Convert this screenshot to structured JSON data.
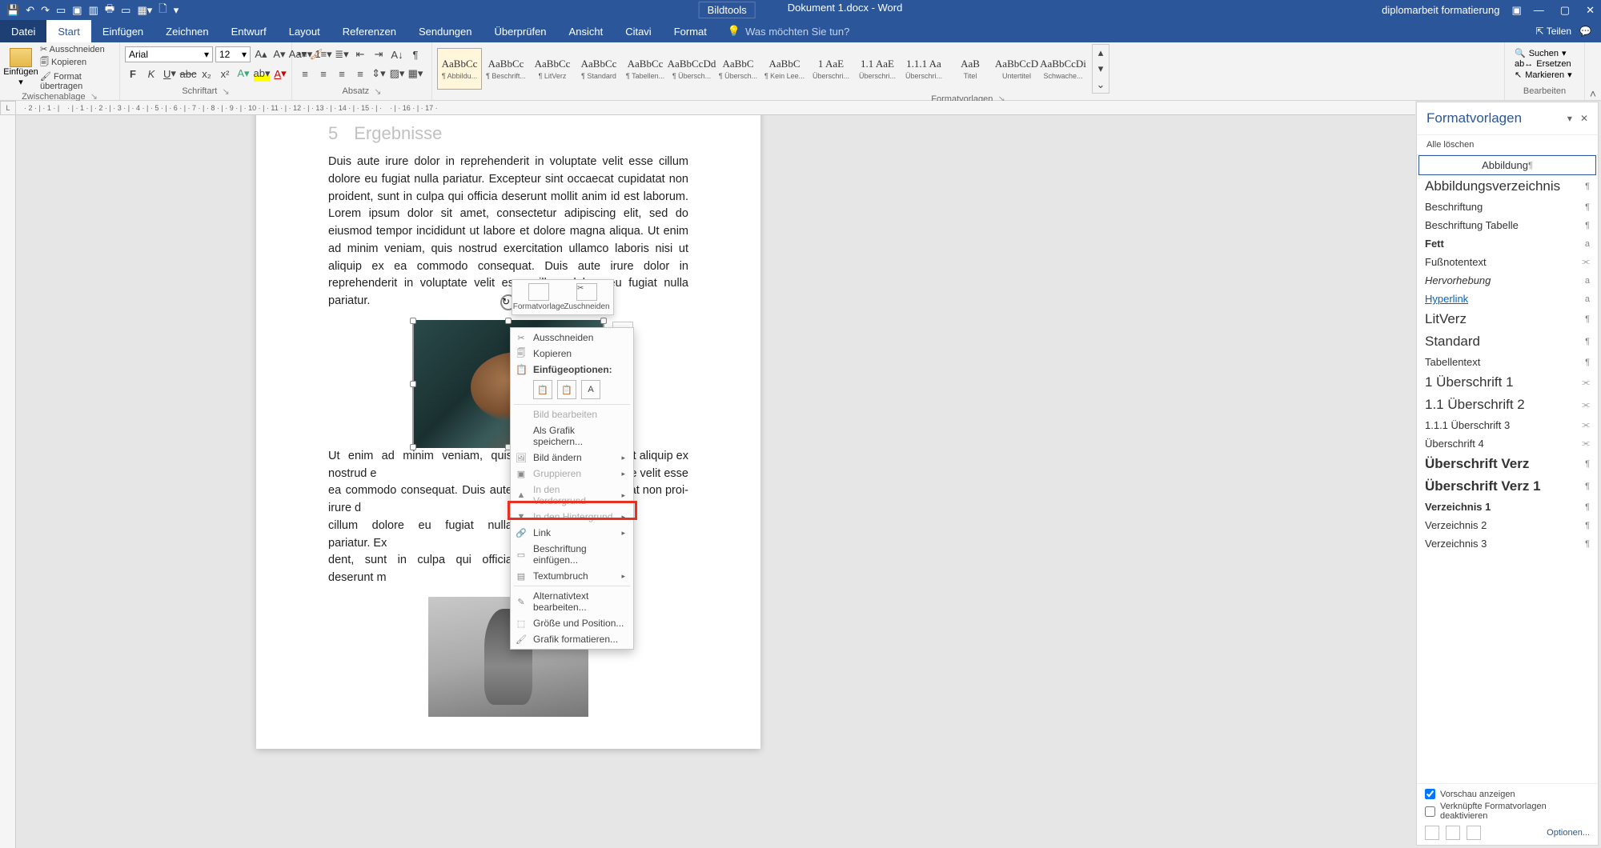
{
  "titlebar": {
    "tools": "Bildtools",
    "docname": "Dokument 1.docx - Word",
    "account": "diplomarbeit formatierung"
  },
  "tabs": {
    "file": "Datei",
    "start": "Start",
    "insert": "Einfügen",
    "draw": "Zeichnen",
    "design": "Entwurf",
    "layout": "Layout",
    "references": "Referenzen",
    "mailings": "Sendungen",
    "review": "Überprüfen",
    "view": "Ansicht",
    "citavi": "Citavi",
    "format": "Format",
    "tellme": "Was möchten Sie tun?",
    "share": "Teilen"
  },
  "ribbon": {
    "clipboard": {
      "label": "Zwischenablage",
      "paste": "Einfügen",
      "cut": "Ausschneiden",
      "copy": "Kopieren",
      "formatpainter": "Format übertragen"
    },
    "font": {
      "label": "Schriftart",
      "name": "Arial",
      "size": "12"
    },
    "paragraph": {
      "label": "Absatz"
    },
    "styles": {
      "label": "Formatvorlagen",
      "items": [
        {
          "sample": "AaBbCc",
          "name": "¶ Abbildu..."
        },
        {
          "sample": "AaBbCc",
          "name": "¶ Beschrift..."
        },
        {
          "sample": "AaBbCc",
          "name": "¶ LitVerz"
        },
        {
          "sample": "AaBbCc",
          "name": "¶ Standard"
        },
        {
          "sample": "AaBbCc",
          "name": "¶ Tabellen..."
        },
        {
          "sample": "AaBbCcDd",
          "name": "¶ Übersch..."
        },
        {
          "sample": "AaBbC",
          "name": "¶ Übersch..."
        },
        {
          "sample": "AaBbC",
          "name": "¶ Kein Lee..."
        },
        {
          "sample": "1 AaE",
          "name": "Überschri..."
        },
        {
          "sample": "1.1 AaE",
          "name": "Überschri..."
        },
        {
          "sample": "1.1.1 Aa",
          "name": "Überschri..."
        },
        {
          "sample": "AaB",
          "name": "Titel"
        },
        {
          "sample": "AaBbCcD",
          "name": "Untertitel"
        },
        {
          "sample": "AaBbCcDi",
          "name": "Schwache..."
        }
      ]
    },
    "edit": {
      "label": "Bearbeiten",
      "find": "Suchen",
      "replace": "Ersetzen",
      "select": "Markieren"
    }
  },
  "document": {
    "heading_num": "5",
    "heading": "Ergebnisse",
    "para1": "Duis aute irure dolor in reprehenderit in voluptate velit esse cillum dolore eu fugiat nulla pariatur. Excepteur sint occaecat cupidatat non proident, sunt in culpa qui officia deserunt mollit anim id est laborum. Lorem ipsum dolor sit amet, consectetur adipiscing elit, sed do eiusmod tempor incididunt ut labore et dolore magna aliqua. Ut enim ad minim veniam, quis nostrud exercitation ullamco laboris nisi ut aliquip ex ea commodo consequat. Duis aute irure dolor in reprehenderit in voluptate velit esse cillum dolore eu fugiat nulla pariatur.",
    "para2a": "Ut enim ad minim veniam, quis nostrud e",
    "para2b": "ea commodo consequat. Duis aute irure d",
    "para2c": "cillum dolore eu fugiat nulla pariatur. Ex",
    "para2d": "dent, sunt in culpa qui officia deserunt m",
    "para2a_r": "si ut aliquip ex",
    "para2b_r": "tate velit esse",
    "para2c_r": "datat non proi-"
  },
  "minitoolbar": {
    "style": "Formatvorlage",
    "crop": "Zuschneiden"
  },
  "context": {
    "cut": "Ausschneiden",
    "copy": "Kopieren",
    "pastehead": "Einfügeoptionen:",
    "editimage": "Bild bearbeiten",
    "saveas": "Als Grafik speichern...",
    "changeimage": "Bild ändern",
    "group": "Gruppieren",
    "front": "In den Vordergrund",
    "back": "In den Hintergrund",
    "link": "Link",
    "caption": "Beschriftung einfügen...",
    "wrap": "Textumbruch",
    "alttext": "Alternativtext bearbeiten...",
    "sizepos": "Größe und Position...",
    "formatgraphic": "Grafik formatieren..."
  },
  "stylespane": {
    "title": "Formatvorlagen",
    "clear": "Alle löschen",
    "items": [
      {
        "name": "Abbildung",
        "mark": "¶",
        "sel": true,
        "centered": true
      },
      {
        "name": "Abbildungsverzeichnis",
        "mark": "¶",
        "cls": "big"
      },
      {
        "name": "Beschriftung",
        "mark": "¶"
      },
      {
        "name": "Beschriftung Tabelle",
        "mark": "¶"
      },
      {
        "name": "Fett",
        "mark": "a",
        "cls": "bold"
      },
      {
        "name": "Fußnotentext",
        "mark": "⫘"
      },
      {
        "name": "Hervorhebung",
        "mark": "a",
        "cls": "italic"
      },
      {
        "name": "Hyperlink",
        "mark": "a",
        "cls": "link"
      },
      {
        "name": "LitVerz",
        "mark": "¶",
        "cls": "big"
      },
      {
        "name": "Standard",
        "mark": "¶",
        "cls": "big"
      },
      {
        "name": "Tabellentext",
        "mark": "¶"
      },
      {
        "name": "1   Überschrift 1",
        "mark": "⫘",
        "cls": "big"
      },
      {
        "name": "1.1  Überschrift 2",
        "mark": "⫘",
        "cls": "big"
      },
      {
        "name": "1.1.1  Überschrift 3",
        "mark": "⫘"
      },
      {
        "name": "Überschrift 4",
        "mark": "⫘"
      },
      {
        "name": "Überschrift Verz",
        "mark": "¶",
        "cls": "big bold"
      },
      {
        "name": "Überschrift Verz 1",
        "mark": "¶",
        "cls": "big bold"
      },
      {
        "name": "Verzeichnis 1",
        "mark": "¶",
        "cls": "bold"
      },
      {
        "name": "Verzeichnis 2",
        "mark": "¶"
      },
      {
        "name": "Verzeichnis 3",
        "mark": "¶"
      }
    ],
    "preview": "Vorschau anzeigen",
    "disable": "Verknüpfte Formatvorlagen deaktivieren",
    "options": "Optionen..."
  }
}
